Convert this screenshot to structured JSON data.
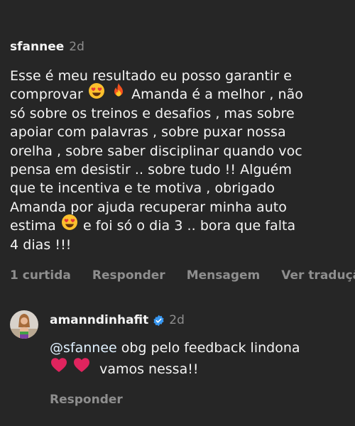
{
  "comment": {
    "username": "sfannee",
    "time": "2d",
    "lines": [
      "Esse é meu resultado eu posso garantir e",
      "comprovar",
      "Amanda é a melhor , não",
      "só sobre os treinos e desafios , mas sobre",
      "apoiar com palavras , sobre puxar nossa",
      "orelha , sobre saber disciplinar quando voc",
      "pensa em desistir .. sobre tudo !! Alguém",
      "que te incentiva e te motiva , obrigado",
      "Amanda por ajuda recuperar minha auto",
      "estima",
      "e foi só o dia 3 .. bora que falta",
      "4 dias !!!"
    ],
    "emojis": [
      "heart-eyes",
      "fire",
      "heart-eyes"
    ],
    "actions": {
      "likes": "1 curtida",
      "reply": "Responder",
      "message": "Mensagem",
      "translate": "Ver tradução"
    }
  },
  "reply": {
    "username": "amanndinhafit",
    "verified": true,
    "time": "2d",
    "mention": "@sfannee",
    "text_line1": "obg pelo feedback lindona",
    "text_line2": "vamos nessa!!",
    "emojis": [
      "red-heart",
      "red-heart"
    ],
    "action_reply": "Responder"
  },
  "colors": {
    "background": "#262626",
    "text": "#f5f5f5",
    "muted": "#8e8e8e",
    "verified": "#3897f0",
    "mention": "#e0f1ff"
  }
}
